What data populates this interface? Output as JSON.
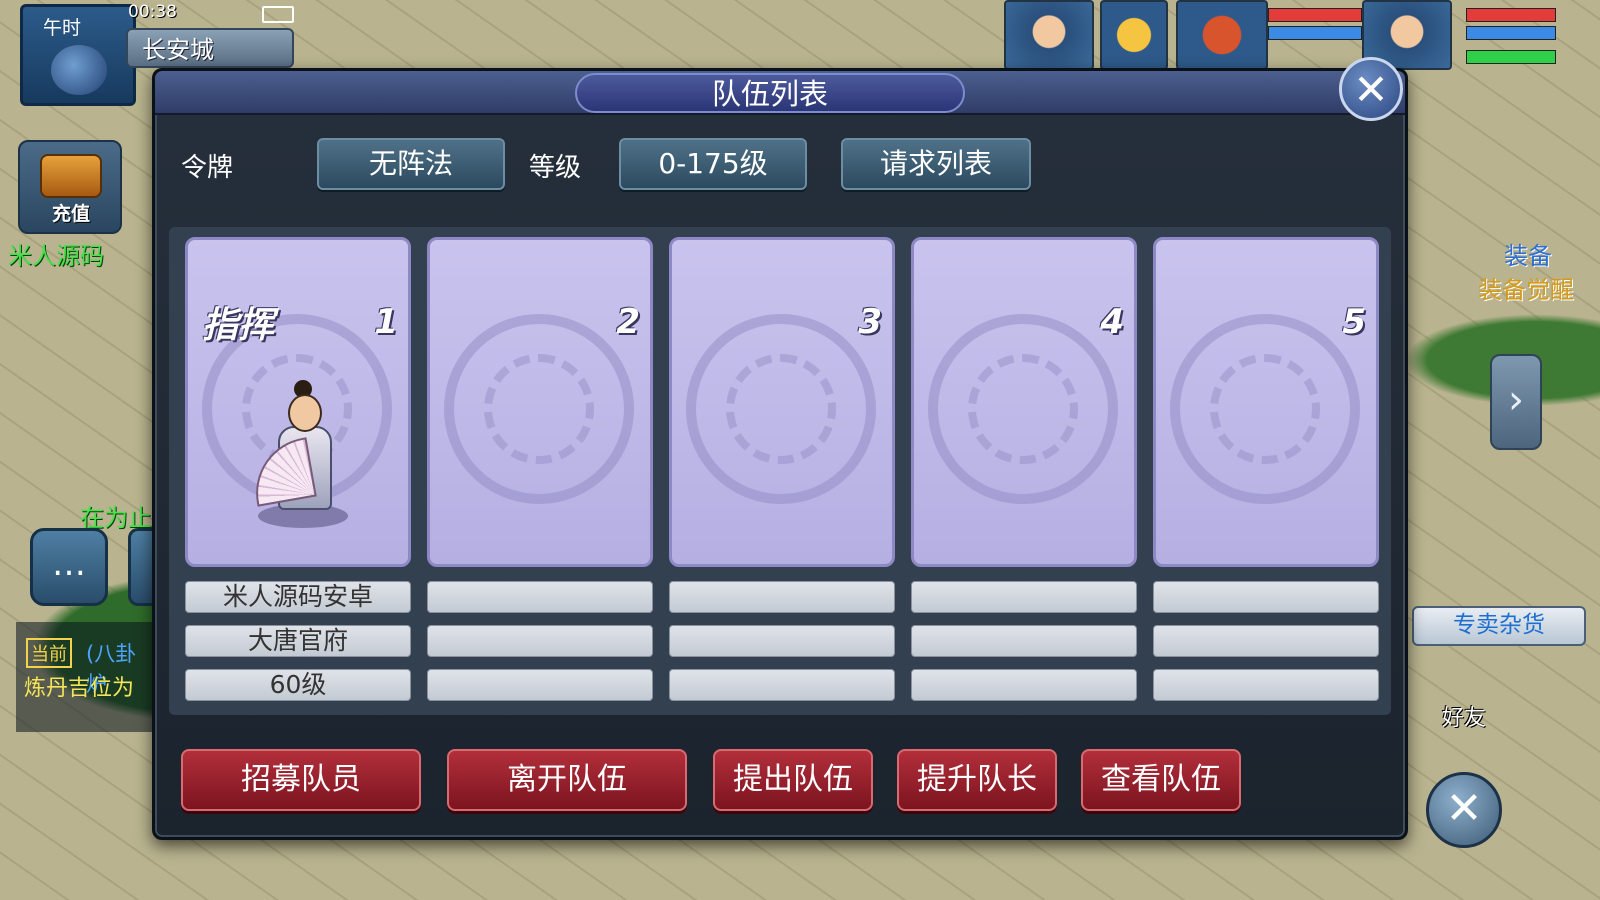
{
  "hud": {
    "time_label": "午时",
    "clock": "00:38",
    "city": "长安城",
    "recharge_label": "充值",
    "chat_left_1": "米人源码",
    "chat_left_2": "在为止",
    "quest_badge": "当前",
    "quest_title": "(八卦炉",
    "quest_text": "炼丹吉位为",
    "equip_1": "装备",
    "equip_2": "装备觉醒",
    "shop_label": "专卖杂货",
    "friend_label": "好友",
    "hud_close_icon": "close-icon",
    "chat_icon": "chat-bubble-icon",
    "arrow_icon": "chevron-right-icon"
  },
  "dialog": {
    "title": "队伍列表",
    "close_icon": "close-icon",
    "token_label": "令牌",
    "formation_button": "无阵法",
    "level_label": "等级",
    "level_range_button": "0-175级",
    "request_list_button": "请求列表",
    "slots": [
      {
        "number": "1",
        "tag": "指挥",
        "name": "米人源码安卓",
        "faction": "大唐官府",
        "level": "60级"
      },
      {
        "number": "2",
        "tag": "",
        "name": "",
        "faction": "",
        "level": ""
      },
      {
        "number": "3",
        "tag": "",
        "name": "",
        "faction": "",
        "level": ""
      },
      {
        "number": "4",
        "tag": "",
        "name": "",
        "faction": "",
        "level": ""
      },
      {
        "number": "5",
        "tag": "",
        "name": "",
        "faction": "",
        "level": ""
      }
    ],
    "actions": {
      "recruit": "招募队员",
      "leave": "离开队伍",
      "kick": "提出队伍",
      "promote": "提升队长",
      "view": "查看队伍"
    }
  },
  "colors": {
    "dialog_bg": "#1b232d",
    "title_bar": "#2f3d68",
    "slot_card": "#c9c3ee",
    "red_button": "#9c1f2c",
    "steel_button": "#3d5e75"
  }
}
